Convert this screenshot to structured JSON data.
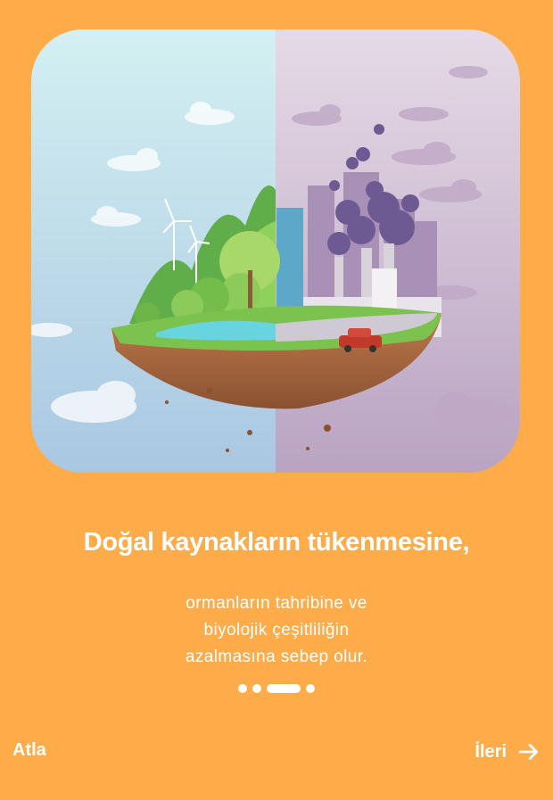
{
  "onboarding": {
    "title": "Doğal kaynakların tükenmesine,",
    "body_lines": [
      "ormanların tahribine ve",
      "biyolojik çeşitliliğin",
      "azalmasına sebep olur."
    ],
    "page_indicator": {
      "total": 4,
      "active_index": 2
    },
    "skip_label": "Atla",
    "next_label": "İleri",
    "next_icon": "arrow-right-icon"
  },
  "illustration": {
    "subject": "floating-island-nature-vs-industry",
    "colors": {
      "background": "#FEAC4A",
      "sky_left": "#CFEFF3",
      "sky_right": "#E3D6E3",
      "grass": "#7CC24E",
      "soil": "#A8663E",
      "smoke": "#6E5A93",
      "car": "#C0392B"
    }
  }
}
